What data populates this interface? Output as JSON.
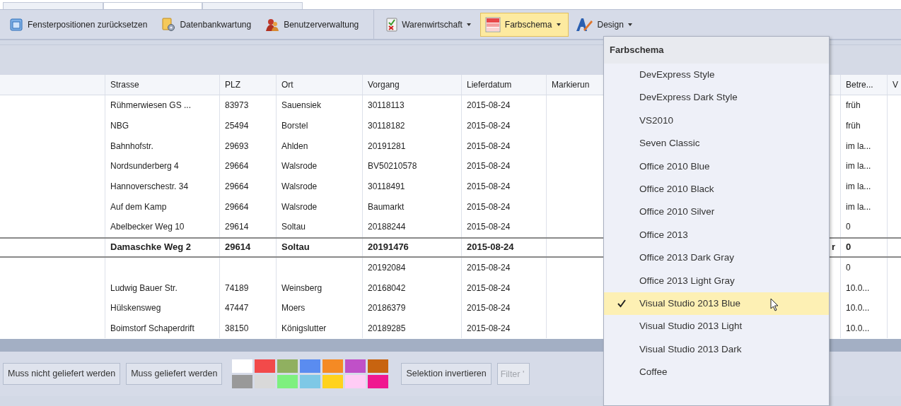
{
  "tabs": [
    {
      "selected": false
    },
    {
      "selected": true
    },
    {
      "selected": false
    }
  ],
  "toolbar": {
    "buttons": [
      {
        "label": "Fensterpositionen zurücksetzen",
        "dropdown": false,
        "open": false
      },
      {
        "label": "Datenbankwartung",
        "dropdown": false,
        "open": false
      },
      {
        "label": "Benutzerverwaltung",
        "dropdown": false,
        "open": false
      },
      {
        "label": "Warenwirtschaft",
        "dropdown": true,
        "open": false
      },
      {
        "label": "Farbschema",
        "dropdown": true,
        "open": true
      },
      {
        "label": "Design",
        "dropdown": true,
        "open": false
      }
    ]
  },
  "table": {
    "header": {
      "strasse": "Strasse",
      "plz": "PLZ",
      "ort": "Ort",
      "vorgang": "Vorgang",
      "lieferdatum": "Lieferdatum",
      "markierung": "Markierun",
      "betreff": "Betre...",
      "column_10": "V"
    },
    "rows": [
      {
        "strasse": "Rühmerwiesen GS ...",
        "plz": "83973",
        "ort": "Sauensiek",
        "vorgang": "30118113",
        "lieferdatum": "2015-08-24",
        "betreff": "früh",
        "selected": false
      },
      {
        "strasse": "NBG",
        "plz": "25494",
        "ort": "Borstel",
        "vorgang": "30118182",
        "lieferdatum": "2015-08-24",
        "betreff": "früh",
        "selected": false
      },
      {
        "strasse": "Bahnhofstr.",
        "plz": "29693",
        "ort": "Ahlden",
        "vorgang": "20191281",
        "lieferdatum": "2015-08-24",
        "betreff": "im la...",
        "selected": false
      },
      {
        "strasse": "Nordsunderberg 4",
        "plz": "29664",
        "ort": "Walsrode",
        "vorgang": "BV50210578",
        "lieferdatum": "2015-08-24",
        "betreff": "im la...",
        "selected": false
      },
      {
        "strasse": "Hannoverschestr. 34",
        "plz": "29664",
        "ort": "Walsrode",
        "vorgang": "30118491",
        "lieferdatum": "2015-08-24",
        "betreff": "im la...",
        "selected": false
      },
      {
        "strasse": "Auf dem Kamp",
        "plz": "29664",
        "ort": "Walsrode",
        "vorgang": "Baumarkt",
        "lieferdatum": "2015-08-24",
        "betreff": "im la...",
        "selected": false
      },
      {
        "strasse": "Abelbecker Weg 10",
        "plz": "29614",
        "ort": "Soltau",
        "vorgang": "20188244",
        "lieferdatum": "2015-08-24",
        "betreff": "0",
        "selected": false
      },
      {
        "strasse": "Damaschke Weg 2",
        "plz": "29614",
        "ort": "Soltau",
        "vorgang": "20191476",
        "lieferdatum": "2015-08-24",
        "column_8": "r",
        "betreff": "0",
        "selected": true
      },
      {
        "vorgang": "20192084",
        "lieferdatum": "2015-08-24",
        "betreff": "0",
        "selected": false
      },
      {
        "strasse": "Ludwig Bauer Str.",
        "plz": "74189",
        "ort": "Weinsberg",
        "vorgang": "20168042",
        "lieferdatum": "2015-08-24",
        "betreff": "10.0...",
        "selected": false
      },
      {
        "strasse": "Hülskensweg",
        "plz": "47447",
        "ort": "Moers",
        "vorgang": "20186379",
        "lieferdatum": "2015-08-24",
        "betreff": "10.0...",
        "selected": false
      },
      {
        "strasse": "Boimstorf Schaperdrift",
        "plz": "38150",
        "ort": "Königslutter",
        "vorgang": "20189285",
        "lieferdatum": "2015-08-24",
        "betreff": "10.0...",
        "selected": false
      }
    ]
  },
  "bottom_bar": {
    "buttons": [
      "Muss nicht geliefert werden",
      "Muss geliefert werden"
    ],
    "swatches": [
      {
        "color": "#ffffff"
      },
      {
        "color": "#f24a4a"
      },
      {
        "color": "#90b060"
      },
      {
        "color": "#5a8cf0"
      },
      {
        "color": "#f58a24"
      },
      {
        "color": "#c050c8"
      },
      {
        "color": "#c86410"
      },
      {
        "color": "#999999"
      },
      {
        "color": "#d9d9d9"
      },
      {
        "color": "#7ef07e"
      },
      {
        "color": "#7ec8e6"
      },
      {
        "color": "#ffd21e"
      },
      {
        "color": "#ffccf5"
      },
      {
        "color": "#f01890"
      }
    ],
    "invert_button": "Selektion invertieren",
    "filter": {
      "placeholder": "Filter '"
    }
  },
  "color_menu": {
    "title": "Farbschema",
    "items": [
      {
        "label": "DevExpress Style",
        "selected": false
      },
      {
        "label": "DevExpress Dark Style",
        "selected": false
      },
      {
        "label": "VS2010",
        "selected": false
      },
      {
        "label": "Seven Classic",
        "selected": false
      },
      {
        "label": "Office 2010 Blue",
        "selected": false
      },
      {
        "label": "Office 2010 Black",
        "selected": false
      },
      {
        "label": "Office 2010 Silver",
        "selected": false
      },
      {
        "label": "Office 2013",
        "selected": false
      },
      {
        "label": "Office 2013 Dark Gray",
        "selected": false
      },
      {
        "label": "Office 2013 Light Gray",
        "selected": false
      },
      {
        "label": "Visual Studio 2013 Blue",
        "selected": true
      },
      {
        "label": "Visual Studio 2013 Light",
        "selected": false
      },
      {
        "label": "Visual Studio 2013 Dark",
        "selected": false
      },
      {
        "label": "Coffee",
        "selected": false
      }
    ]
  }
}
